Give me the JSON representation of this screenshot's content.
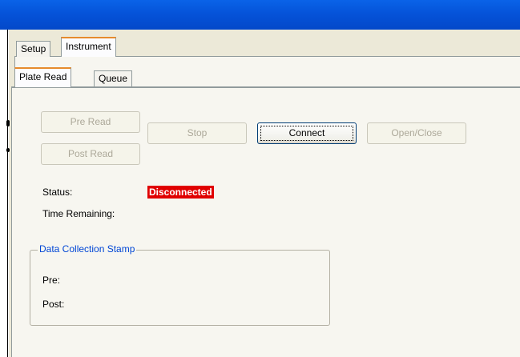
{
  "outer_tabs": [
    {
      "label": "Setup",
      "active": false
    },
    {
      "label": "Instrument",
      "active": true
    }
  ],
  "inner_tabs": [
    {
      "label": "Plate Read",
      "active": true
    },
    {
      "label": "Queue",
      "active": false
    }
  ],
  "buttons": {
    "pre_read": "Pre Read",
    "post_read": "Post Read",
    "stop": "Stop",
    "connect": "Connect",
    "open_close": "Open/Close"
  },
  "status": {
    "label": "Status:",
    "value": "Disconnected",
    "value_color": "#e00000"
  },
  "time_remaining": {
    "label": "Time Remaining:",
    "value": ""
  },
  "data_collection_stamp": {
    "title": "Data Collection Stamp",
    "pre_label": "Pre:",
    "post_label": "Post:"
  }
}
